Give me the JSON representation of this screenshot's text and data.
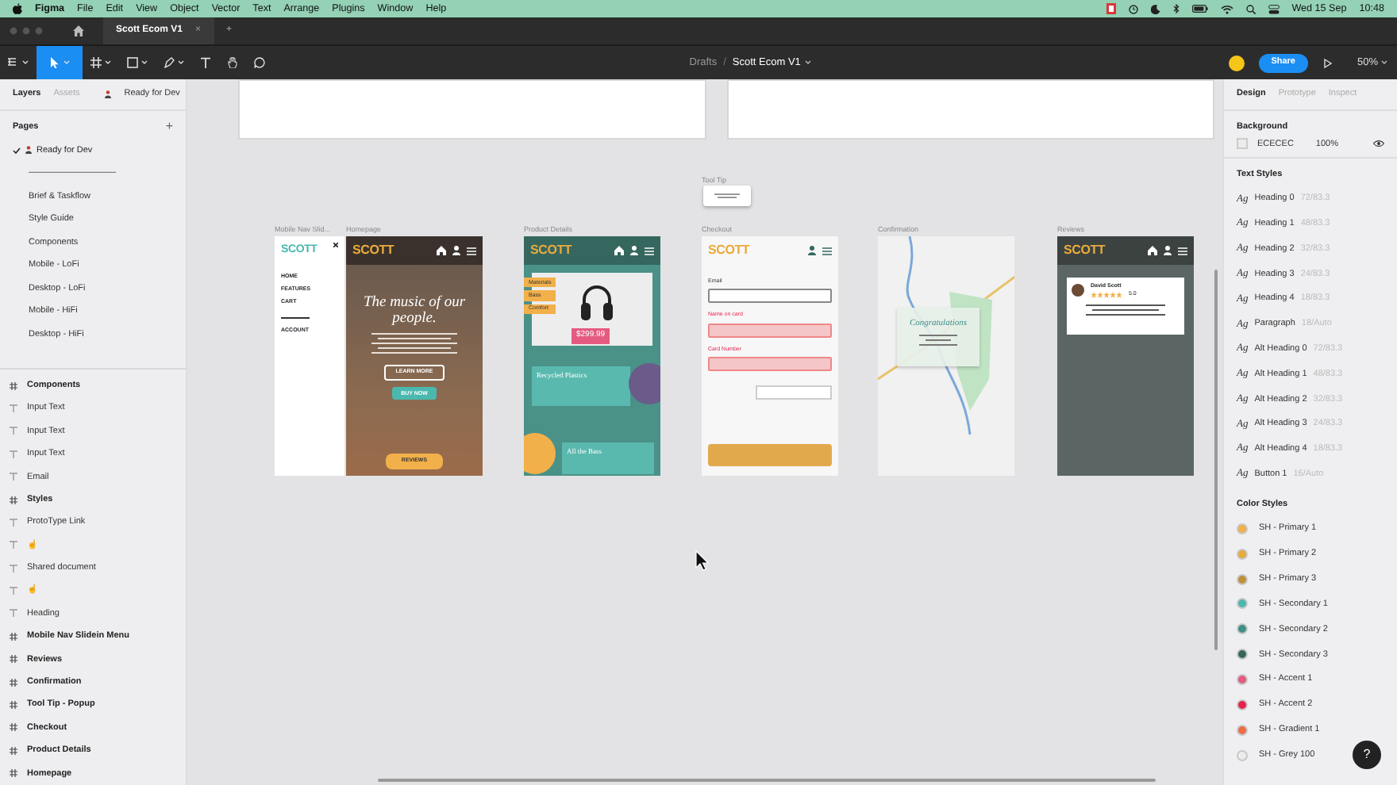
{
  "menu_bar": {
    "app": "Figma",
    "menus": [
      "File",
      "Edit",
      "View",
      "Object",
      "Vector",
      "Text",
      "Arrange",
      "Plugins",
      "Window",
      "Help"
    ],
    "date": "Wed 15 Sep",
    "time": "10:48"
  },
  "tab_bar": {
    "tabs": [
      {
        "label": "Scott Ecom V1",
        "close": "×",
        "selected": true
      }
    ],
    "new_tab": "+"
  },
  "toolbar": {
    "tools": [
      {
        "kind": "menu",
        "selected": false
      },
      {
        "kind": "move",
        "selected": true
      },
      {
        "kind": "frame",
        "selected": false
      },
      {
        "kind": "shape",
        "selected": false
      },
      {
        "kind": "pen",
        "selected": false
      },
      {
        "kind": "text",
        "selected": false
      },
      {
        "kind": "hand",
        "selected": false
      },
      {
        "kind": "comment",
        "selected": false
      }
    ],
    "breadcrumb": "Drafts",
    "separator": "/",
    "file_name": "Scott Ecom V1",
    "share": "Share",
    "zoom": "50%"
  },
  "left_panel": {
    "tabs": [
      {
        "label": "Layers",
        "selected": true
      },
      {
        "label": "Assets",
        "selected": false
      }
    ],
    "current_page": "Ready for Dev",
    "pages_title": "Pages",
    "add": "+",
    "pages": [
      {
        "label": "Ready for Dev",
        "selected": true
      },
      {
        "label": "——————————",
        "selected": false
      },
      {
        "label": "Brief & Taskflow",
        "selected": false
      },
      {
        "label": "Style Guide",
        "selected": false
      },
      {
        "label": "Components",
        "selected": false
      },
      {
        "label": "Mobile - LoFi",
        "selected": false
      },
      {
        "label": "Desktop - LoFi",
        "selected": false
      },
      {
        "label": "Mobile - HiFi",
        "selected": false
      },
      {
        "label": "Desktop - HiFi",
        "selected": false
      }
    ],
    "layers": [
      {
        "label": "Components",
        "kind": "frame"
      },
      {
        "label": "Input Text",
        "kind": "text"
      },
      {
        "label": "Input Text",
        "kind": "text"
      },
      {
        "label": "Input Text",
        "kind": "text"
      },
      {
        "label": "Email",
        "kind": "text"
      },
      {
        "label": "Styles",
        "kind": "frame"
      },
      {
        "label": "ProtoType Link",
        "kind": "text"
      },
      {
        "label": "☝",
        "kind": "emoji"
      },
      {
        "label": "Shared document",
        "kind": "text"
      },
      {
        "label": "☝",
        "kind": "emoji"
      },
      {
        "label": "Heading",
        "kind": "text"
      },
      {
        "label": "Mobile Nav Slidein Menu",
        "kind": "frame"
      },
      {
        "label": "Reviews",
        "kind": "frame"
      },
      {
        "label": "Confirmation",
        "kind": "frame"
      },
      {
        "label": "Tool Tip - Popup",
        "kind": "frame"
      },
      {
        "label": "Checkout",
        "kind": "frame"
      },
      {
        "label": "Product Details",
        "kind": "frame"
      },
      {
        "label": "Homepage",
        "kind": "frame"
      }
    ]
  },
  "canvas": {
    "tooltip": {
      "label": "Tool Tip"
    },
    "frames": [
      {
        "kind": "nav",
        "label": "Mobile Nav Slid...",
        "logo": "SCOTT",
        "links": [
          "HOME",
          "FEATURES",
          "CART",
          "ACCOUNT"
        ]
      },
      {
        "kind": "home",
        "label": "Homepage",
        "logo": "SCOTT",
        "headline": "The music of our people.",
        "buttons": [
          "LEARN MORE",
          "BUY NOW",
          "REVIEWS"
        ]
      },
      {
        "kind": "product",
        "label": "Product Details",
        "logo": "SCOTT",
        "tags": [
          "Materials",
          "Bass",
          "Comfort"
        ],
        "price": "$299.99",
        "cards": [
          "Recycled Plastics",
          "All the Bass"
        ]
      },
      {
        "kind": "checkout",
        "label": "Checkout",
        "logo": "SCOTT",
        "fields": [
          {
            "label": "Email",
            "error": false
          },
          {
            "label": "Name on card",
            "error": true
          },
          {
            "label": "Card Number",
            "error": true
          }
        ]
      },
      {
        "kind": "confirm",
        "label": "Confirmation",
        "title": "Congratulations"
      },
      {
        "kind": "reviews",
        "label": "Reviews",
        "logo": "SCOTT",
        "reviewer": "David Scott",
        "stars": 5,
        "score": "5.0"
      }
    ]
  },
  "right_panel": {
    "tabs": [
      {
        "label": "Design",
        "selected": true
      },
      {
        "label": "Prototype",
        "selected": false
      },
      {
        "label": "Inspect",
        "selected": false
      }
    ],
    "background": {
      "title": "Background",
      "hex": "ECECEC",
      "opacity": "100%"
    },
    "text_styles_title": "Text Styles",
    "text_styles": [
      {
        "sample": "Ag",
        "name": "Heading 0",
        "spec": "72/83.3"
      },
      {
        "sample": "Ag",
        "name": "Heading 1",
        "spec": "48/83.3"
      },
      {
        "sample": "Ag",
        "name": "Heading 2",
        "spec": "32/83.3"
      },
      {
        "sample": "Ag",
        "name": "Heading 3",
        "spec": "24/83.3"
      },
      {
        "sample": "Ag",
        "name": "Heading 4",
        "spec": "18/83.3"
      },
      {
        "sample": "Ag",
        "name": "Paragraph",
        "spec": "18/Auto"
      },
      {
        "sample": "Ag",
        "name": "Alt Heading 0",
        "spec": "72/83.3"
      },
      {
        "sample": "Ag",
        "name": "Alt Heading 1",
        "spec": "48/83.3"
      },
      {
        "sample": "Ag",
        "name": "Alt Heading 2",
        "spec": "32/83.3"
      },
      {
        "sample": "Ag",
        "name": "Alt Heading 3",
        "spec": "24/83.3"
      },
      {
        "sample": "Ag",
        "name": "Alt Heading 4",
        "spec": "18/83.3"
      },
      {
        "sample": "Ag",
        "name": "Button 1",
        "spec": "16/Auto"
      }
    ],
    "color_styles_title": "Color Styles",
    "color_styles": [
      {
        "name": "SH - Primary 1",
        "color": "#f2b04a"
      },
      {
        "name": "SH - Primary 2",
        "color": "#e9a93b"
      },
      {
        "name": "SH - Primary 3",
        "color": "#c0913a"
      },
      {
        "name": "SH - Secondary 1",
        "color": "#4bb8ae"
      },
      {
        "name": "SH - Secondary 2",
        "color": "#3f8f86"
      },
      {
        "name": "SH - Secondary 3",
        "color": "#35675f"
      },
      {
        "name": "SH - Accent 1",
        "color": "#e55a7f"
      },
      {
        "name": "SH - Accent 2",
        "color": "#e8204f"
      },
      {
        "name": "SH - Gradient 1",
        "color": "#ef6c45"
      },
      {
        "name": "SH - Grey 100",
        "color": "#ececec"
      }
    ],
    "help": "?"
  }
}
